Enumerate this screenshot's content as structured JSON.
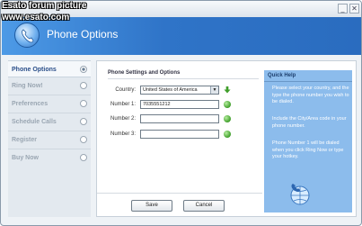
{
  "watermark": {
    "line1": "Esato forum picture",
    "line2": "www.esato.com"
  },
  "window": {
    "minimize_icon": "minimize-icon",
    "close_icon": "close-icon"
  },
  "header": {
    "title": "Phone Options",
    "icon": "phone-icon"
  },
  "sidebar": {
    "items": [
      {
        "label": "Phone Options",
        "active": true
      },
      {
        "label": "Ring Now!",
        "active": false
      },
      {
        "label": "Preferences",
        "active": false
      },
      {
        "label": "Schedule Calls",
        "active": false
      },
      {
        "label": "Register",
        "active": false
      },
      {
        "label": "Buy Now",
        "active": false
      }
    ]
  },
  "form": {
    "section_title": "Phone Settings and Options",
    "country_label": "Country:",
    "country_value": "United States of America",
    "number1_label": "Number 1:",
    "number1_value": "7035551212",
    "number2_label": "Number 2:",
    "number2_value": "",
    "number3_label": "Number 3:",
    "number3_value": ""
  },
  "help": {
    "title": "Quick Help",
    "para1": "Please select your country, and the type the phone number you wish to be dialed.",
    "para2": "Include the City/Area code in your phone number.",
    "para3": "Phone Number 1 will be dialed when you click Ring Now or type your hotkey.",
    "icon": "globe-phone-icon"
  },
  "buttons": {
    "save": "Save",
    "cancel": "Cancel"
  },
  "colors": {
    "banner": "#2f74c8",
    "help_bg": "#8cbcec",
    "go_green": "#3f9e2a"
  }
}
